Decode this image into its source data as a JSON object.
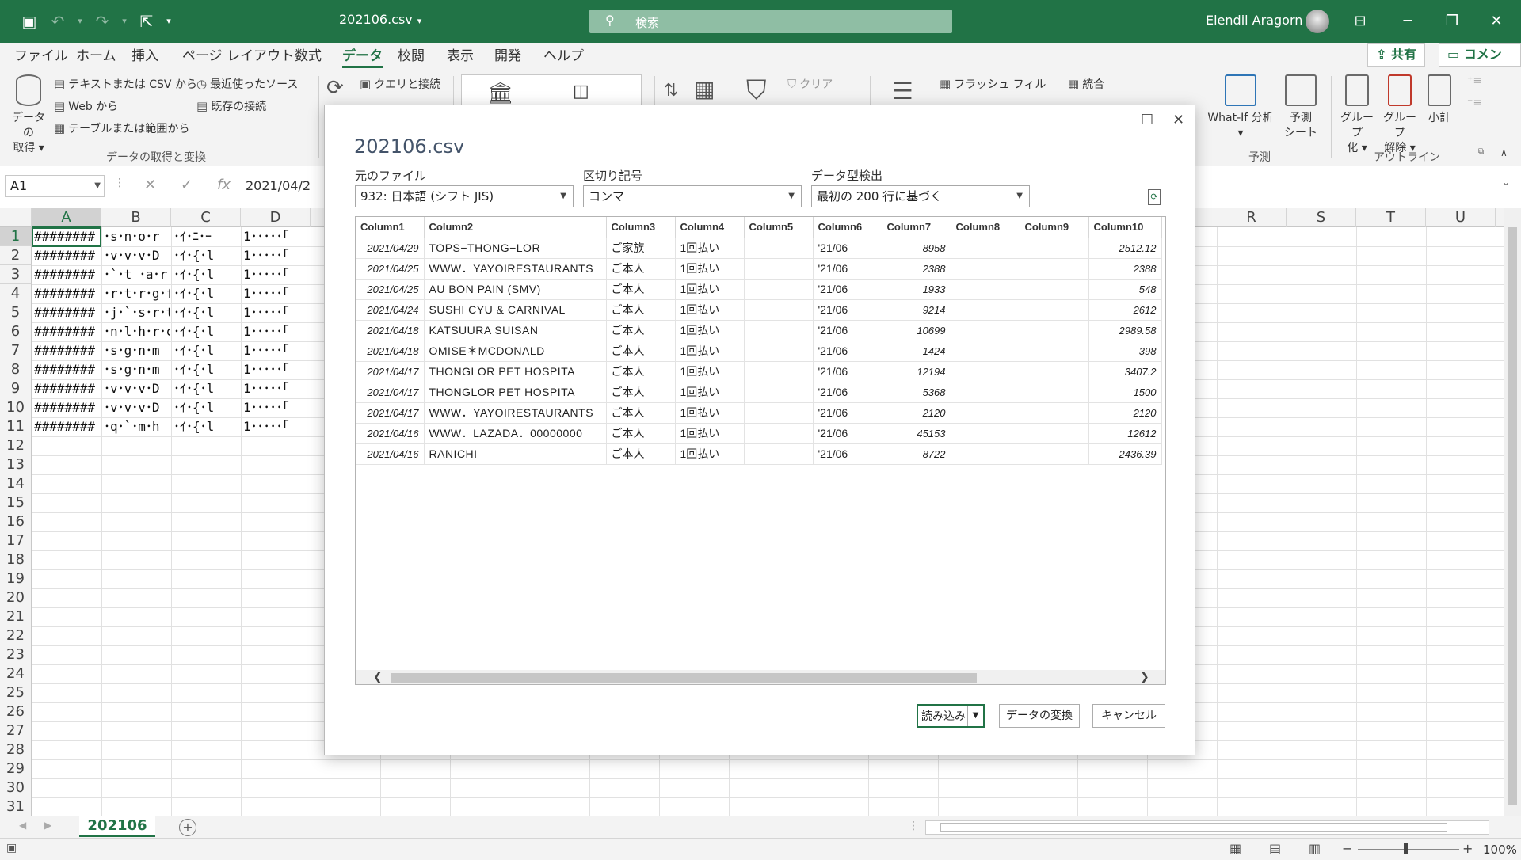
{
  "titlebar": {
    "doc_title": "202106.csv",
    "search_placeholder": "検索",
    "user_name": "Elendil Aragorn"
  },
  "tabs": [
    "ファイル",
    "ホーム",
    "挿入",
    "ページ レイアウト",
    "数式",
    "データ",
    "校閲",
    "表示",
    "開発",
    "ヘルプ"
  ],
  "active_tab": "データ",
  "share": {
    "share_label": "共有",
    "comment_label": "コメント"
  },
  "ribbon": {
    "get_data_line1": "データの",
    "get_data_line2": "取得",
    "from_text_csv": "テキストまたは CSV から",
    "from_web": "Web から",
    "from_table": "テーブルまたは範囲から",
    "recent_sources": "最近使ったソース",
    "existing_connections": "既存の接続",
    "group_get_transform": "データの取得と変換",
    "queries_connections": "クエリと接続",
    "clear": "クリア",
    "flash_fill": "フラッシュ フィル",
    "consolidate": "統合",
    "whatif_line1": "What-If 分析",
    "forecast_line1": "予測",
    "forecast_line2": "シート",
    "group_forecast": "予測",
    "group_line1": "グループ",
    "group_line2": "化",
    "ungroup_line1": "グループ",
    "ungroup_line2": "解除",
    "subtotal": "小計",
    "group_outline": "アウトライン"
  },
  "formula_bar": {
    "cell_ref": "A1",
    "formula": "2021/04/2"
  },
  "grid": {
    "columns": [
      "A",
      "B",
      "C",
      "D",
      "R",
      "S",
      "T",
      "U"
    ],
    "rows": [
      "1",
      "2",
      "3",
      "4",
      "5",
      "6",
      "7",
      "8",
      "9",
      "10",
      "11",
      "12",
      "13",
      "14",
      "15",
      "16",
      "17",
      "18",
      "19",
      "20",
      "21",
      "22",
      "23",
      "24",
      "25",
      "26",
      "27",
      "28",
      "29",
      "30",
      "31"
    ],
    "cells": [
      [
        "########",
        "･s･n･o･r",
        "･ｲ･ﾆ･ｰ",
        "1･････｢"
      ],
      [
        "########",
        "･v･v･v･D",
        "･ｲ･{･l",
        "1･････｢"
      ],
      [
        "########",
        "･`･t ･a･r",
        "･ｲ･{･l",
        "1･････｢"
      ],
      [
        "########",
        "･r･t･r･g･f",
        "･ｲ･{･l",
        "1･････｢"
      ],
      [
        "########",
        "･j･`･s･r･t",
        "･ｲ･{･l",
        "1･････｢"
      ],
      [
        "########",
        "･n･l･h･r･c",
        "･ｲ･{･l",
        "1･････｢"
      ],
      [
        "########",
        "･s･g･n･m",
        "･ｲ･{･l",
        "1･････｢"
      ],
      [
        "########",
        "･s･g･n･m",
        "･ｲ･{･l",
        "1･････｢"
      ],
      [
        "########",
        "･v･v･v･D",
        "･ｲ･{･l",
        "1･････｢"
      ],
      [
        "########",
        "･v･v･v･D",
        "･ｲ･{･l",
        "1･････｢"
      ],
      [
        "########",
        "･q･`･m･h",
        "･ｲ･{･l",
        "1･････｢"
      ]
    ]
  },
  "sheet": {
    "tab_name": "202106",
    "zoom": "100%"
  },
  "dialog": {
    "title": "202106.csv",
    "file_origin_label": "元のファイル",
    "file_origin_value": "932: 日本語 (シフト JIS)",
    "delimiter_label": "区切り記号",
    "delimiter_value": "コンマ",
    "type_detect_label": "データ型検出",
    "type_detect_value": "最初の 200 行に基づく",
    "headers": [
      "Column1",
      "Column2",
      "Column3",
      "Column4",
      "Column5",
      "Column6",
      "Column7",
      "Column8",
      "Column9",
      "Column10"
    ],
    "rows": [
      [
        "2021/04/29",
        "TOPS−THONG−LOR",
        "ご家族",
        "1回払い",
        "",
        "'21/06",
        "8958",
        "",
        "",
        "2512.12"
      ],
      [
        "2021/04/25",
        "WWW．YAYOIRESTAURANTS",
        "ご本人",
        "1回払い",
        "",
        "'21/06",
        "2388",
        "",
        "",
        "2388"
      ],
      [
        "2021/04/25",
        "AU BON PAIN (SMV)",
        "ご本人",
        "1回払い",
        "",
        "'21/06",
        "1933",
        "",
        "",
        "548"
      ],
      [
        "2021/04/24",
        "SUSHI CYU & CARNIVAL",
        "ご本人",
        "1回払い",
        "",
        "'21/06",
        "9214",
        "",
        "",
        "2612"
      ],
      [
        "2021/04/18",
        "KATSUURA SUISAN",
        "ご本人",
        "1回払い",
        "",
        "'21/06",
        "10699",
        "",
        "",
        "2989.58"
      ],
      [
        "2021/04/18",
        "OMISE＊MCDONALD",
        "ご本人",
        "1回払い",
        "",
        "'21/06",
        "1424",
        "",
        "",
        "398"
      ],
      [
        "2021/04/17",
        "THONGLOR PET HOSPITA",
        "ご本人",
        "1回払い",
        "",
        "'21/06",
        "12194",
        "",
        "",
        "3407.2"
      ],
      [
        "2021/04/17",
        "THONGLOR PET HOSPITA",
        "ご本人",
        "1回払い",
        "",
        "'21/06",
        "5368",
        "",
        "",
        "1500"
      ],
      [
        "2021/04/17",
        "WWW．YAYOIRESTAURANTS",
        "ご本人",
        "1回払い",
        "",
        "'21/06",
        "2120",
        "",
        "",
        "2120"
      ],
      [
        "2021/04/16",
        "WWW．LAZADA．00000000",
        "ご本人",
        "1回払い",
        "",
        "'21/06",
        "45153",
        "",
        "",
        "12612"
      ],
      [
        "2021/04/16",
        "RANICHI",
        "ご本人",
        "1回払い",
        "",
        "'21/06",
        "8722",
        "",
        "",
        "2436.39"
      ]
    ],
    "load_label": "読み込み",
    "transform_label": "データの変換",
    "cancel_label": "キャンセル"
  }
}
